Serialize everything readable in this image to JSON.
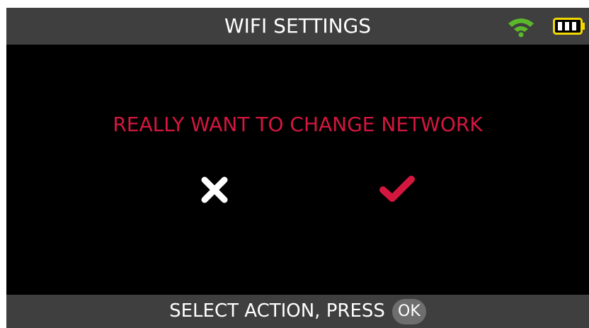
{
  "header": {
    "title": "WIFI SETTINGS",
    "wifi_icon": "wifi-icon",
    "battery_icon": "battery-icon"
  },
  "dialog": {
    "prompt": "REALLY WANT TO CHANGE NETWORK",
    "cancel_icon": "close-icon",
    "confirm_icon": "checkmark-icon"
  },
  "footer": {
    "instruction": "SELECT ACTION, PRESS",
    "ok_label": "OK"
  },
  "colors": {
    "header_bg": "#3f3f3f",
    "screen_bg": "#000000",
    "prompt": "#d4173f",
    "wifi": "#5bb82a",
    "battery": "#f2d900",
    "confirm": "#d4173f",
    "cancel": "#ffffff"
  }
}
